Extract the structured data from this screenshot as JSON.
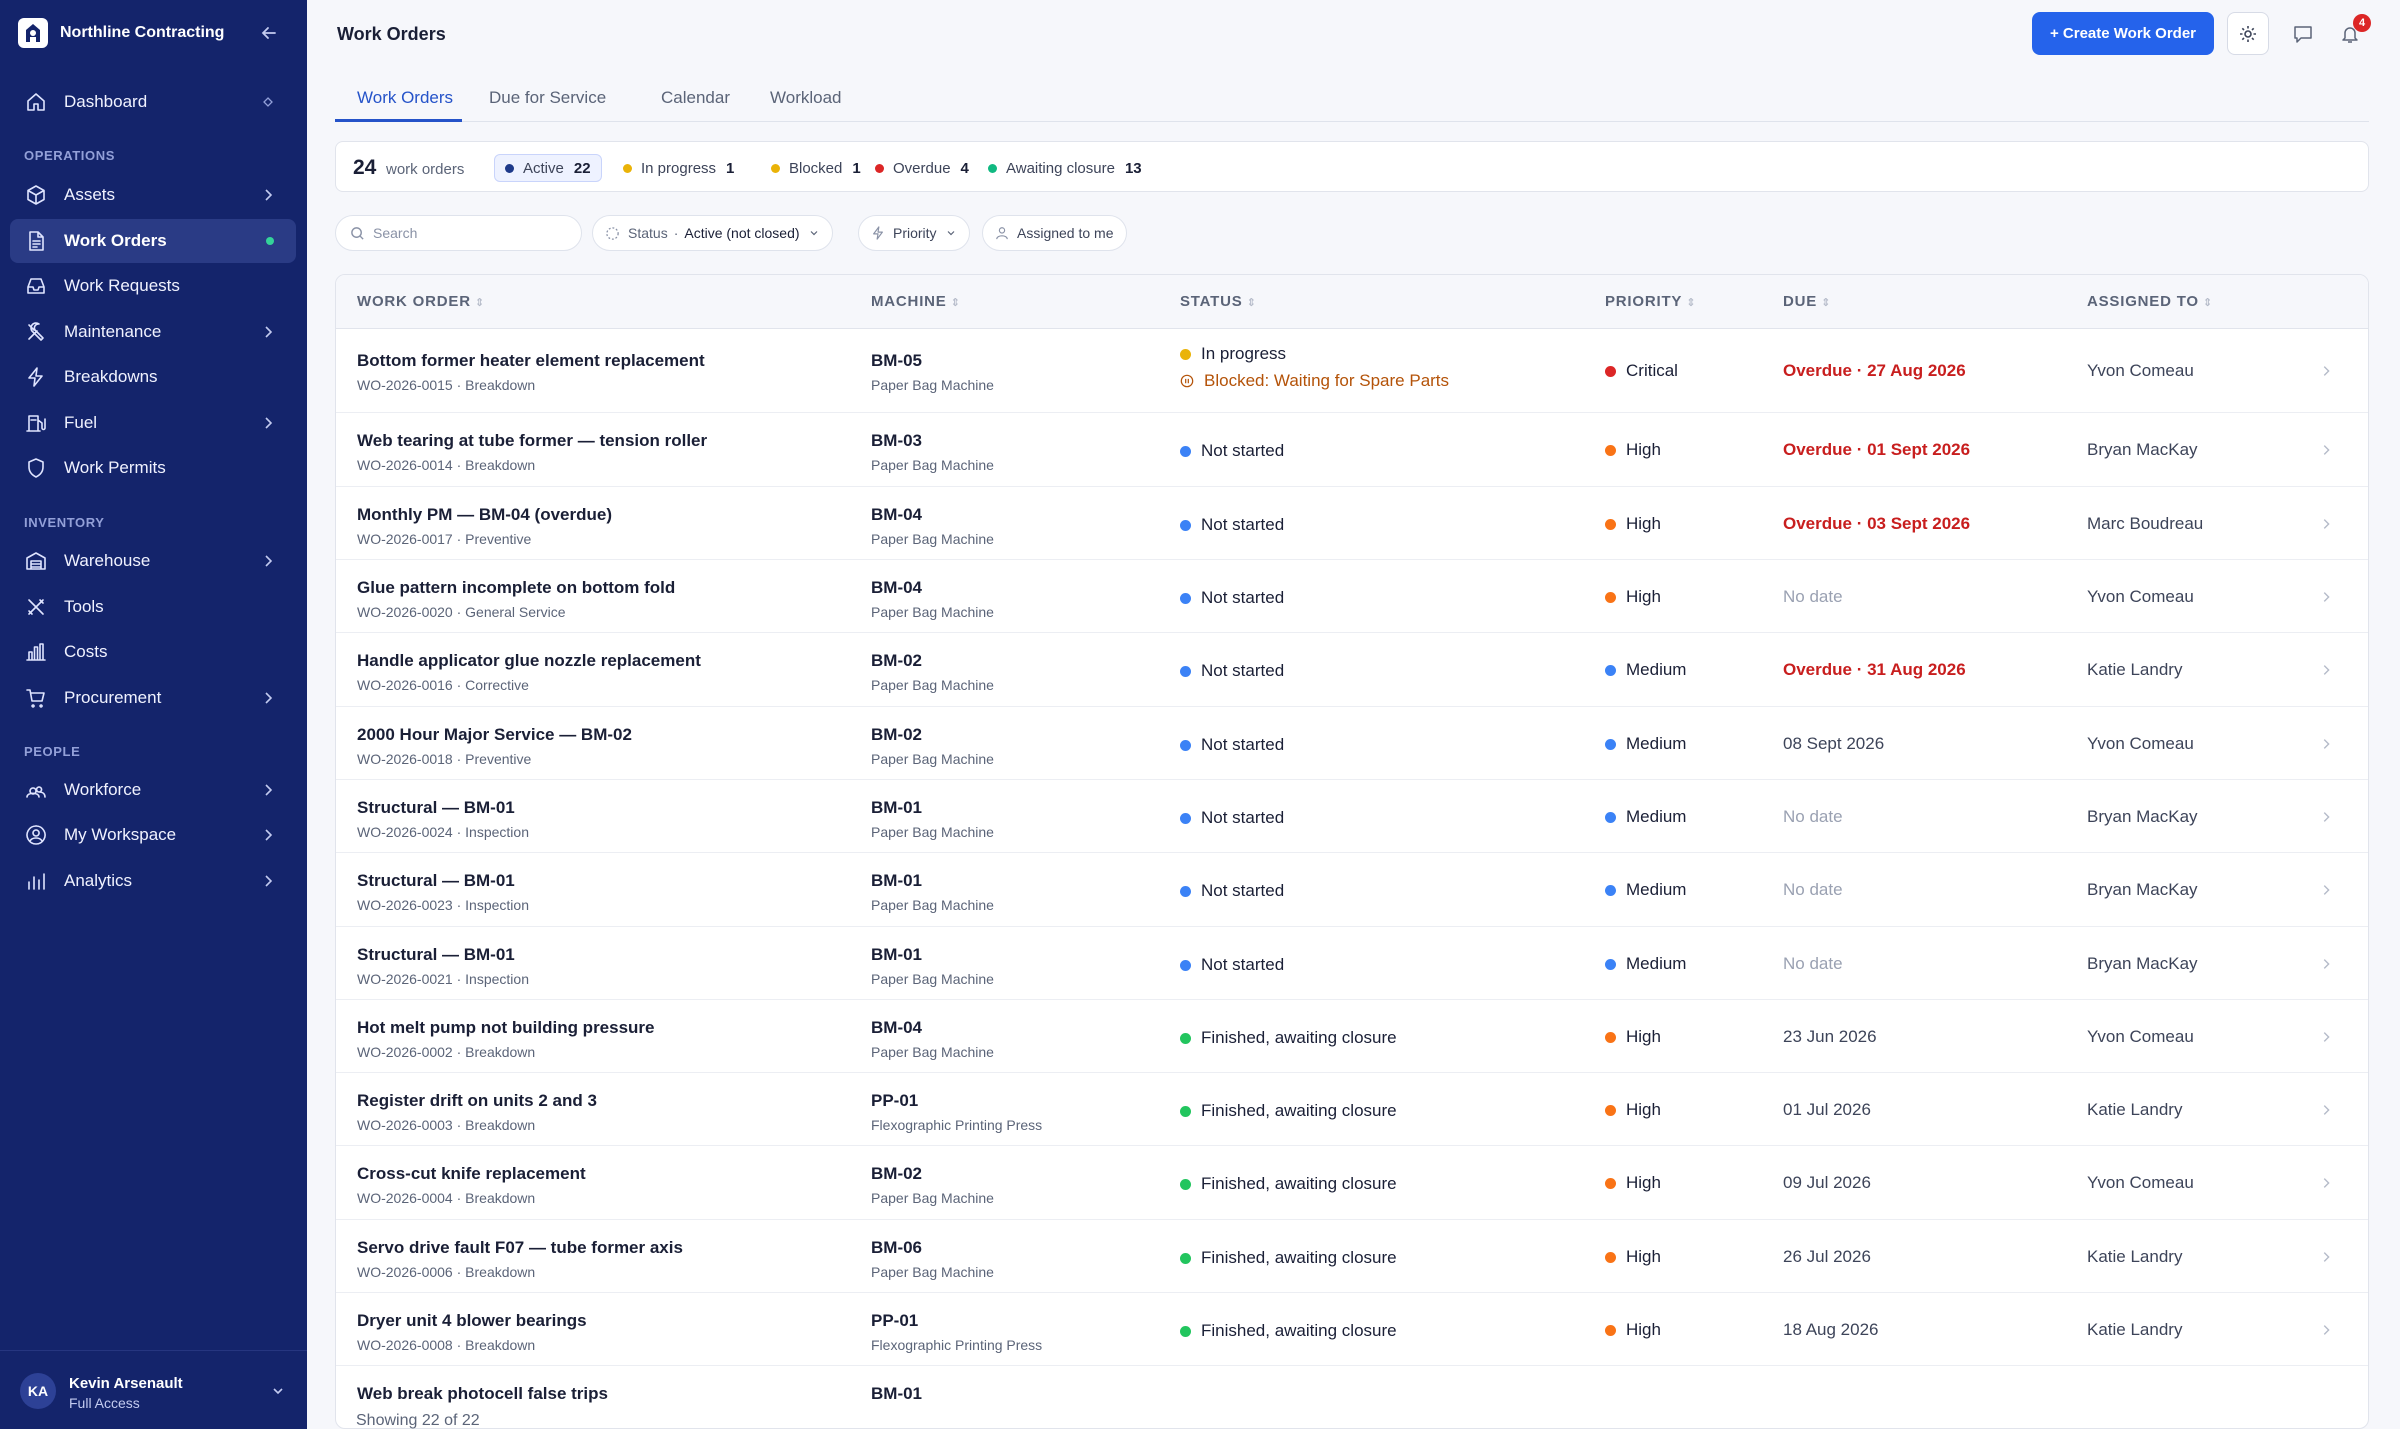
{
  "brand": {
    "name": "Northline Contracting"
  },
  "sidebar": {
    "top": [
      {
        "label": "Dashboard",
        "icon": "home-icon"
      }
    ],
    "sections": [
      {
        "title": "OPERATIONS",
        "items": [
          {
            "label": "Assets",
            "icon": "cube-icon",
            "chevron": true
          },
          {
            "label": "Work Orders",
            "icon": "document-icon",
            "active": true
          },
          {
            "label": "Work Requests",
            "icon": "inbox-icon"
          },
          {
            "label": "Maintenance",
            "icon": "wrench-icon",
            "chevron": true
          },
          {
            "label": "Breakdowns",
            "icon": "bolt-icon"
          },
          {
            "label": "Fuel",
            "icon": "fuel-icon",
            "chevron": true
          },
          {
            "label": "Work Permits",
            "icon": "shield-icon"
          }
        ]
      },
      {
        "title": "INVENTORY",
        "items": [
          {
            "label": "Warehouse",
            "icon": "warehouse-icon",
            "chevron": true
          },
          {
            "label": "Tools",
            "icon": "tools-icon"
          },
          {
            "label": "Costs",
            "icon": "bar-chart-icon"
          },
          {
            "label": "Procurement",
            "icon": "cart-icon",
            "chevron": true
          }
        ]
      },
      {
        "title": "PEOPLE",
        "items": [
          {
            "label": "Workforce",
            "icon": "people-icon",
            "chevron": true
          },
          {
            "label": "My Workspace",
            "icon": "user-circle-icon",
            "chevron": true
          },
          {
            "label": "Analytics",
            "icon": "analytics-icon",
            "chevron": true
          }
        ]
      }
    ]
  },
  "user": {
    "initials": "KA",
    "name": "Kevin Arsenault",
    "role": "Full Access"
  },
  "header": {
    "title": "Work Orders",
    "create_label": "+ Create Work Order",
    "notifications": "4"
  },
  "tabs": [
    "Work Orders",
    "Due for Service",
    "Calendar",
    "Workload"
  ],
  "summary": {
    "count": "24",
    "count_label": "work orders",
    "chips": [
      {
        "label": "Active",
        "count": "22",
        "color": "#1e3a8a",
        "selected": true
      },
      {
        "label": "In progress",
        "count": "1",
        "color": "#eab308"
      },
      {
        "label": "Blocked",
        "count": "1",
        "color": "#eab308"
      },
      {
        "label": "Overdue",
        "count": "4",
        "color": "#dc2626"
      },
      {
        "label": "Awaiting closure",
        "count": "13",
        "color": "#10b981"
      }
    ]
  },
  "filters": {
    "search_placeholder": "Search",
    "status_label": "Status",
    "status_value": "Active (not closed)",
    "priority_label": "Priority",
    "assigned_label": "Assigned to me"
  },
  "columns": [
    "WORK ORDER",
    "MACHINE",
    "STATUS",
    "PRIORITY",
    "DUE",
    "ASSIGNED TO"
  ],
  "rows": [
    {
      "title": "Bottom former heater element replacement",
      "sub": "WO-2026-0015 · Breakdown",
      "machine": "BM-05",
      "machine_type": "Paper Bag Machine",
      "status": "In progress",
      "status_color": "#eab308",
      "blocked": "Blocked: Waiting for Spare Parts",
      "priority": "Critical",
      "priority_color": "#dc2626",
      "due": "Overdue · 27 Aug 2026",
      "due_kind": "overdue",
      "assigned": "Yvon Comeau"
    },
    {
      "title": "Web tearing at tube former — tension roller",
      "sub": "WO-2026-0014 · Breakdown",
      "machine": "BM-03",
      "machine_type": "Paper Bag Machine",
      "status": "Not started",
      "status_color": "#3b82f6",
      "priority": "High",
      "priority_color": "#f97316",
      "due": "Overdue · 01 Sept 2026",
      "due_kind": "overdue",
      "assigned": "Bryan MacKay"
    },
    {
      "title": "Monthly PM — BM-04 (overdue)",
      "sub": "WO-2026-0017 · Preventive",
      "machine": "BM-04",
      "machine_type": "Paper Bag Machine",
      "status": "Not started",
      "status_color": "#3b82f6",
      "priority": "High",
      "priority_color": "#f97316",
      "due": "Overdue · 03 Sept 2026",
      "due_kind": "overdue",
      "assigned": "Marc Boudreau"
    },
    {
      "title": "Glue pattern incomplete on bottom fold",
      "sub": "WO-2026-0020 · General Service",
      "machine": "BM-04",
      "machine_type": "Paper Bag Machine",
      "status": "Not started",
      "status_color": "#3b82f6",
      "priority": "High",
      "priority_color": "#f97316",
      "due": "No date",
      "due_kind": "nodate",
      "assigned": "Yvon Comeau"
    },
    {
      "title": "Handle applicator glue nozzle replacement",
      "sub": "WO-2026-0016 · Corrective",
      "machine": "BM-02",
      "machine_type": "Paper Bag Machine",
      "status": "Not started",
      "status_color": "#3b82f6",
      "priority": "Medium",
      "priority_color": "#3b82f6",
      "due": "Overdue · 31 Aug 2026",
      "due_kind": "overdue",
      "assigned": "Katie Landry"
    },
    {
      "title": "2000 Hour Major Service — BM-02",
      "sub": "WO-2026-0018 · Preventive",
      "machine": "BM-02",
      "machine_type": "Paper Bag Machine",
      "status": "Not started",
      "status_color": "#3b82f6",
      "priority": "Medium",
      "priority_color": "#3b82f6",
      "due": "08 Sept 2026",
      "due_kind": "plain",
      "assigned": "Yvon Comeau"
    },
    {
      "title": "Structural — BM-01",
      "sub": "WO-2026-0024 · Inspection",
      "machine": "BM-01",
      "machine_type": "Paper Bag Machine",
      "status": "Not started",
      "status_color": "#3b82f6",
      "priority": "Medium",
      "priority_color": "#3b82f6",
      "due": "No date",
      "due_kind": "nodate",
      "assigned": "Bryan MacKay"
    },
    {
      "title": "Structural — BM-01",
      "sub": "WO-2026-0023 · Inspection",
      "machine": "BM-01",
      "machine_type": "Paper Bag Machine",
      "status": "Not started",
      "status_color": "#3b82f6",
      "priority": "Medium",
      "priority_color": "#3b82f6",
      "due": "No date",
      "due_kind": "nodate",
      "assigned": "Bryan MacKay"
    },
    {
      "title": "Structural — BM-01",
      "sub": "WO-2026-0021 · Inspection",
      "machine": "BM-01",
      "machine_type": "Paper Bag Machine",
      "status": "Not started",
      "status_color": "#3b82f6",
      "priority": "Medium",
      "priority_color": "#3b82f6",
      "due": "No date",
      "due_kind": "nodate",
      "assigned": "Bryan MacKay"
    },
    {
      "title": "Hot melt pump not building pressure",
      "sub": "WO-2026-0002 · Breakdown",
      "machine": "BM-04",
      "machine_type": "Paper Bag Machine",
      "status": "Finished, awaiting closure",
      "status_color": "#22c55e",
      "priority": "High",
      "priority_color": "#f97316",
      "due": "23 Jun 2026",
      "due_kind": "plain",
      "assigned": "Yvon Comeau"
    },
    {
      "title": "Register drift on units 2 and 3",
      "sub": "WO-2026-0003 · Breakdown",
      "machine": "PP-01",
      "machine_type": "Flexographic Printing Press",
      "status": "Finished, awaiting closure",
      "status_color": "#22c55e",
      "priority": "High",
      "priority_color": "#f97316",
      "due": "01 Jul 2026",
      "due_kind": "plain",
      "assigned": "Katie Landry"
    },
    {
      "title": "Cross-cut knife replacement",
      "sub": "WO-2026-0004 · Breakdown",
      "machine": "BM-02",
      "machine_type": "Paper Bag Machine",
      "status": "Finished, awaiting closure",
      "status_color": "#22c55e",
      "priority": "High",
      "priority_color": "#f97316",
      "due": "09 Jul 2026",
      "due_kind": "plain",
      "assigned": "Yvon Comeau"
    },
    {
      "title": "Servo drive fault F07 — tube former axis",
      "sub": "WO-2026-0006 · Breakdown",
      "machine": "BM-06",
      "machine_type": "Paper Bag Machine",
      "status": "Finished, awaiting closure",
      "status_color": "#22c55e",
      "priority": "High",
      "priority_color": "#f97316",
      "due": "26 Jul 2026",
      "due_kind": "plain",
      "assigned": "Katie Landry"
    },
    {
      "title": "Dryer unit 4 blower bearings",
      "sub": "WO-2026-0008 · Breakdown",
      "machine": "PP-01",
      "machine_type": "Flexographic Printing Press",
      "status": "Finished, awaiting closure",
      "status_color": "#22c55e",
      "priority": "High",
      "priority_color": "#f97316",
      "due": "18 Aug 2026",
      "due_kind": "plain",
      "assigned": "Katie Landry"
    },
    {
      "title": "Web break photocell false trips",
      "machine": "BM-01"
    }
  ],
  "footer": {
    "showing": "Showing 22 of 22"
  }
}
